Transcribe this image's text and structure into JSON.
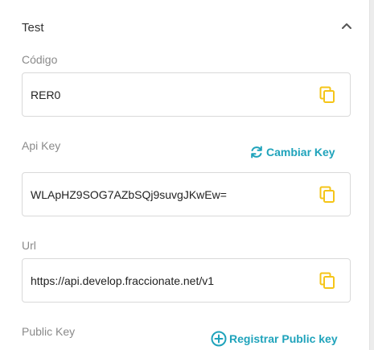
{
  "section": {
    "title": "Test"
  },
  "fields": {
    "codigo": {
      "label": "Código",
      "value": "RER0"
    },
    "api_key": {
      "label": "Api Key",
      "value": "WLApHZ9SOG7AZbSQj9suvgJKwEw=",
      "action_label": "Cambiar Key"
    },
    "url": {
      "label": "Url",
      "value": "https://api.develop.fraccionate.net/v1"
    },
    "public_key": {
      "label": "Public Key",
      "action_label": "Registrar Public key"
    }
  },
  "icons": {
    "collapse": "chevron-up-icon",
    "copy": "copy-icon",
    "refresh": "refresh-icon",
    "add": "add-circle-icon"
  },
  "colors": {
    "accent": "#1fa3bb",
    "copy_icon": "#f5c518",
    "label": "#8a8a8a"
  }
}
